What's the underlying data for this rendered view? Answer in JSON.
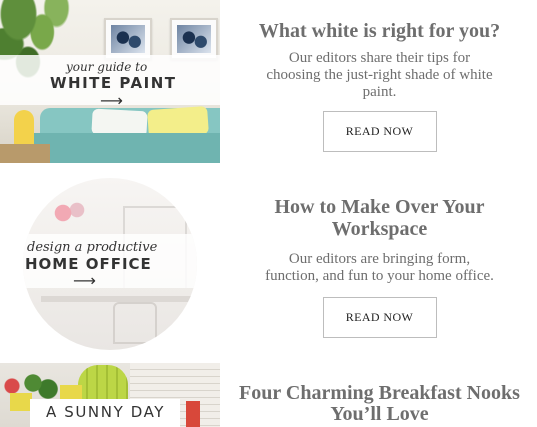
{
  "articles": [
    {
      "image_script": "your guide to",
      "image_caps": "WHITE PAINT",
      "arrow": "⟶",
      "title": "What white is right for you?",
      "description": "Our editors share their tips for choosing the just-right shade of white paint.",
      "button_label": "READ NOW"
    },
    {
      "image_script": "design a productive",
      "image_caps": "HOME OFFICE",
      "arrow": "⟶",
      "title": "How to Make Over Your Workspace",
      "description": "Our editors are bringing form, function, and fun to your home office.",
      "button_label": "READ NOW"
    },
    {
      "image_caps": "A SUNNY DAY",
      "title_line1": "Four Charming Breakfast Nooks",
      "title_line2": "You’ll Love"
    }
  ]
}
